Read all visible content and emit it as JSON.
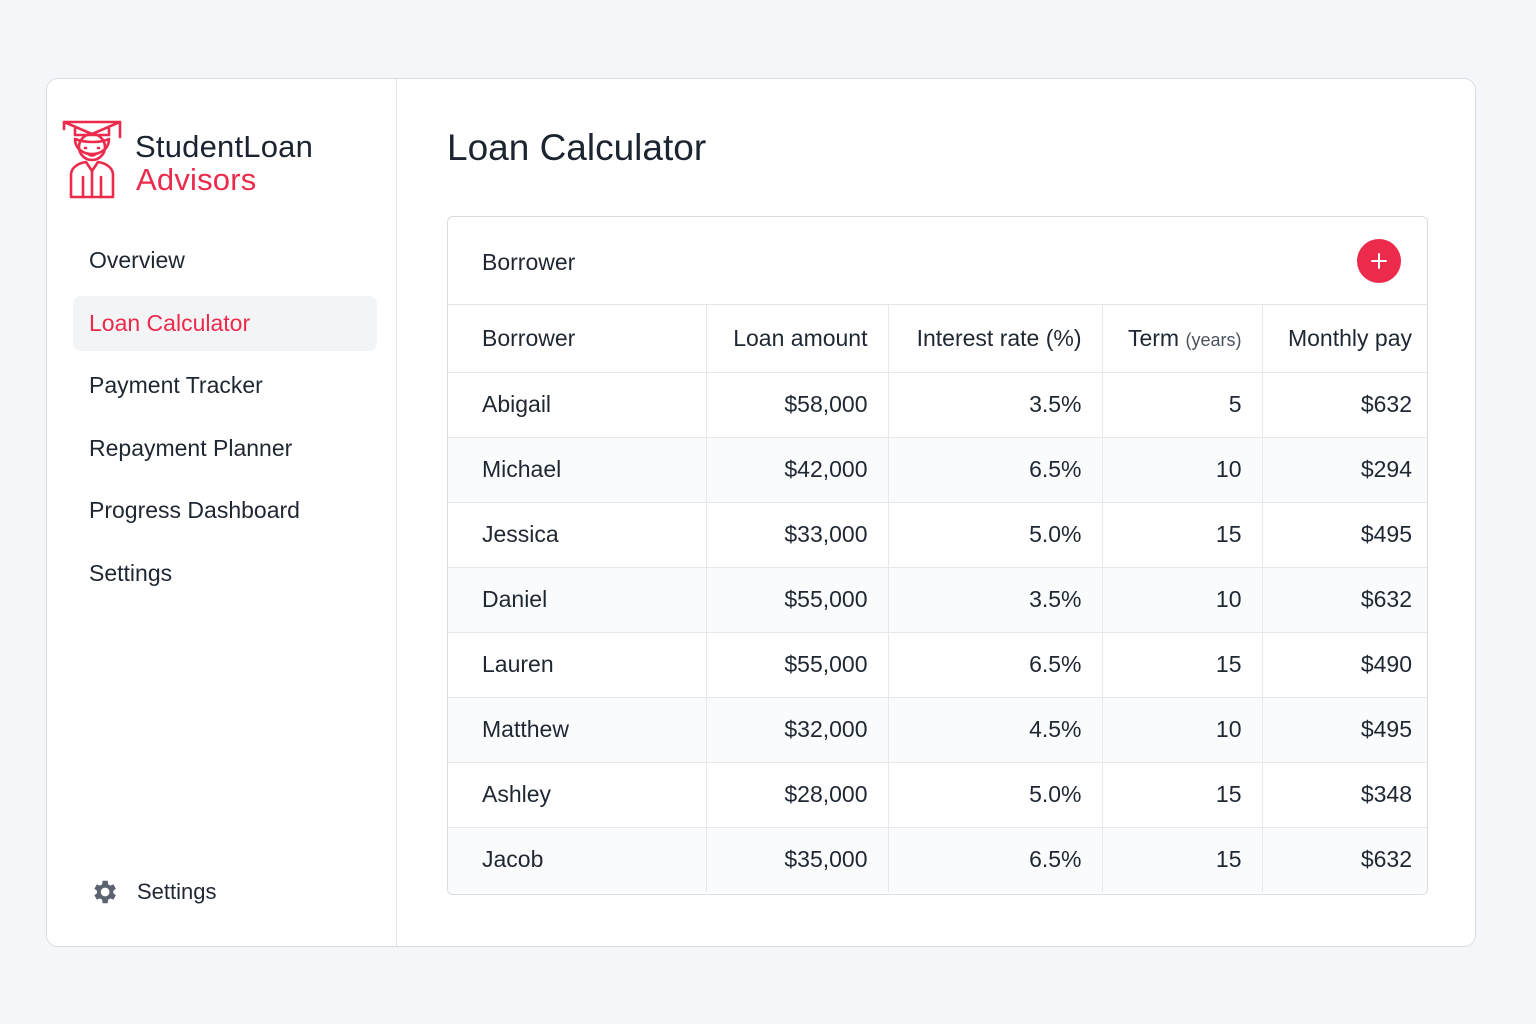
{
  "brand": {
    "line1": "StudentLoan",
    "line2": "Advisors",
    "logo_icon": "graduate-icon",
    "accent": "#ec2a4b"
  },
  "nav": {
    "items": [
      {
        "label": "Overview",
        "active": false
      },
      {
        "label": "Loan Calculator",
        "active": true
      },
      {
        "label": "Payment Tracker",
        "active": false
      },
      {
        "label": "Repayment Planner",
        "active": false
      },
      {
        "label": "Progress Dashboard",
        "active": false
      },
      {
        "label": "Settings",
        "active": false
      }
    ]
  },
  "footer": {
    "label": "Settings",
    "icon": "gear-icon"
  },
  "page": {
    "title": "Loan Calculator"
  },
  "card": {
    "title": "Borrower",
    "add_icon": "plus-icon",
    "columns": {
      "borrower": "Borrower",
      "loan_amount": "Loan amount",
      "interest_rate": "Interest rate (%)",
      "term": "Term",
      "term_unit": "(years)",
      "monthly_pay": "Monthly pay"
    },
    "rows": [
      {
        "name": "Abigail",
        "amount": "$58,000",
        "rate": "3.5%",
        "term": "5",
        "monthly": "$632"
      },
      {
        "name": "Michael",
        "amount": "$42,000",
        "rate": "6.5%",
        "term": "10",
        "monthly": "$294"
      },
      {
        "name": "Jessica",
        "amount": "$33,000",
        "rate": "5.0%",
        "term": "15",
        "monthly": "$495"
      },
      {
        "name": "Daniel",
        "amount": "$55,000",
        "rate": "3.5%",
        "term": "10",
        "monthly": "$632"
      },
      {
        "name": "Lauren",
        "amount": "$55,000",
        "rate": "6.5%",
        "term": "15",
        "monthly": "$490"
      },
      {
        "name": "Matthew",
        "amount": "$32,000",
        "rate": "4.5%",
        "term": "10",
        "monthly": "$495"
      },
      {
        "name": "Ashley",
        "amount": "$28,000",
        "rate": "5.0%",
        "term": "15",
        "monthly": "$348"
      },
      {
        "name": "Jacob",
        "amount": "$35,000",
        "rate": "6.5%",
        "term": "15",
        "monthly": "$632"
      }
    ]
  }
}
